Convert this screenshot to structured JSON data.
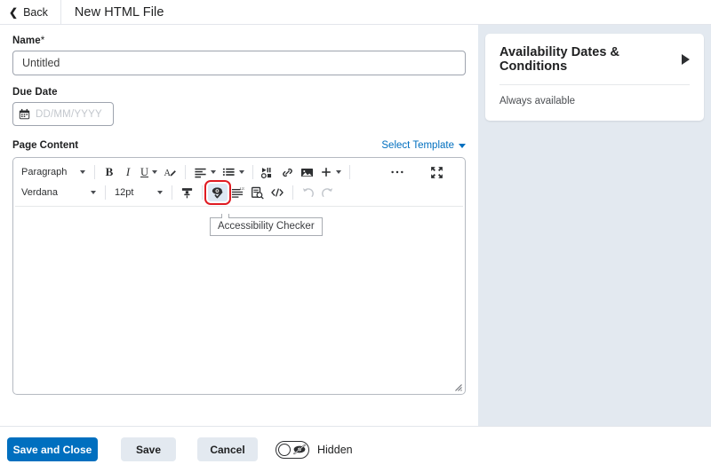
{
  "topbar": {
    "back_label": "Back",
    "file_title": "New HTML File"
  },
  "form": {
    "name_label": "Name",
    "name_required_mark": "*",
    "name_value": "Untitled",
    "due_date_label": "Due Date",
    "due_date_placeholder": "DD/MM/YYYY"
  },
  "page_content": {
    "label": "Page Content",
    "select_template_label": "Select Template"
  },
  "editor": {
    "row1": {
      "paragraph_style": "Paragraph",
      "bold_label": "B",
      "italic_label": "I",
      "underline_label": "U",
      "text_color_label": "A"
    },
    "row2": {
      "font_family": "Verdana",
      "font_size": "12pt"
    },
    "body_text": ""
  },
  "tooltip": {
    "text": "Accessibility Checker"
  },
  "availability": {
    "title": "Availability Dates & Conditions",
    "status": "Always available"
  },
  "bottombar": {
    "save_and_close_label": "Save and Close",
    "save_label": "Save",
    "cancel_label": "Cancel",
    "visibility_label": "Hidden"
  },
  "colors": {
    "accent_blue": "#006fbf",
    "highlight_red": "#e01b22",
    "panel_bg": "#e3e9f0",
    "active_tool_bg": "#dde8f3"
  }
}
